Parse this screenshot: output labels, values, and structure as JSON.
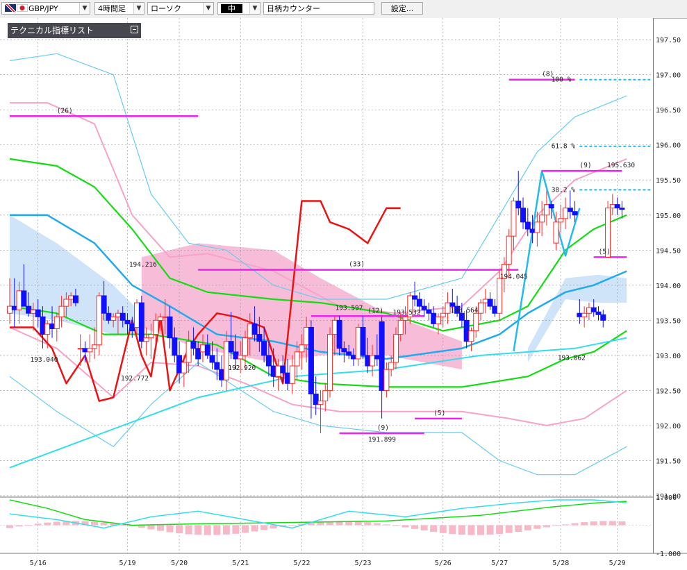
{
  "toolbar": {
    "pair": "GBP/JPY",
    "timeframe": "4時間足",
    "chart_style": "ローソク",
    "size": "中",
    "counter": "日柄カウンター",
    "settings": "設定..."
  },
  "legend_panel": {
    "title": "テクニカル指標リスト"
  },
  "colors": {
    "up_candle": "#ff2a2a",
    "down_candle": "#1010ff",
    "kumo_bull": "#f7bdd8",
    "kumo_bear": "#cfe4f8",
    "ma_green": "#11dd11",
    "ma_blue": "#22aaee",
    "ma_cyan": "#33ddee",
    "bb_pink": "#f7a2c9",
    "bb_sky": "#66ccf0",
    "chikou_red": "#ee1111",
    "magenta": "#ee22ee",
    "fib": "#22bbee"
  },
  "chart_data": {
    "type": "candlestick",
    "symbol": "GBP/JPY",
    "timeframe": "4時間足",
    "ylim": [
      191.0,
      197.6
    ],
    "y_ticks": [
      "197.50",
      "197.00",
      "196.50",
      "196.00",
      "195.50",
      "195.00",
      "194.50",
      "194.00",
      "193.50",
      "193.00",
      "192.50",
      "192.00",
      "191.50",
      "191.00"
    ],
    "y_tick_values": [
      197.5,
      197.0,
      196.5,
      196.0,
      195.5,
      195.0,
      194.5,
      194.0,
      193.5,
      193.0,
      192.5,
      192.0,
      191.5,
      191.0
    ],
    "x_labels": [
      "5/16",
      "5/19",
      "5/20",
      "5/21",
      "5/22",
      "5/23",
      "5/26",
      "5/27",
      "5/28",
      "5/29"
    ],
    "x_label_index": [
      6,
      25,
      36,
      49,
      62,
      75,
      92,
      104,
      117,
      129
    ],
    "candles": [
      [
        0,
        193.6,
        194.1,
        193.45,
        193.7
      ],
      [
        1,
        193.7,
        194.1,
        193.4,
        193.65
      ],
      [
        2,
        193.65,
        194.05,
        193.45,
        193.92
      ],
      [
        3,
        193.92,
        194.3,
        193.7,
        193.7
      ],
      [
        4,
        193.7,
        193.9,
        193.55,
        193.6
      ],
      [
        5,
        193.6,
        193.75,
        193.35,
        193.65
      ],
      [
        6,
        193.65,
        193.8,
        193.4,
        193.55
      ],
      [
        7,
        193.55,
        193.7,
        193.1,
        193.3
      ],
      [
        8,
        193.3,
        193.5,
        193.1,
        193.45
      ],
      [
        9,
        193.45,
        193.7,
        193.25,
        193.38
      ],
      [
        10,
        193.38,
        193.6,
        193.2,
        193.55
      ],
      [
        11,
        193.55,
        193.85,
        193.4,
        193.7
      ],
      [
        12,
        193.7,
        193.9,
        193.55,
        193.8
      ],
      [
        13,
        193.8,
        193.9,
        193.7,
        193.85
      ],
      [
        14,
        193.85,
        193.95,
        193.7,
        193.75
      ],
      [
        15,
        193.1,
        193.3,
        192.85,
        193.1
      ],
      [
        16,
        193.1,
        193.2,
        192.9,
        193.05
      ],
      [
        17,
        193.05,
        193.3,
        192.9,
        193.1
      ],
      [
        18,
        193.1,
        193.4,
        192.95,
        193.15
      ],
      [
        19,
        193.15,
        193.9,
        193.0,
        193.85
      ],
      [
        20,
        193.85,
        194.06,
        193.5,
        193.6
      ],
      [
        21,
        193.6,
        193.7,
        193.45,
        193.5
      ],
      [
        22,
        193.5,
        193.6,
        193.4,
        193.55
      ],
      [
        23,
        193.55,
        193.65,
        193.3,
        193.6
      ],
      [
        24,
        193.6,
        193.7,
        193.4,
        193.5
      ],
      [
        25,
        193.5,
        193.6,
        193.3,
        193.45
      ],
      [
        26,
        193.45,
        193.55,
        193.25,
        193.35
      ],
      [
        27,
        193.4,
        193.8,
        193.3,
        193.75
      ],
      [
        28,
        193.75,
        193.85,
        193.1,
        193.2
      ],
      [
        29,
        193.2,
        193.4,
        193.0,
        193.25
      ],
      [
        30,
        193.25,
        193.45,
        192.95,
        193.3
      ],
      [
        31,
        193.3,
        193.6,
        193.1,
        193.5
      ],
      [
        32,
        193.5,
        193.6,
        193.35,
        193.55
      ],
      [
        33,
        193.55,
        193.8,
        193.3,
        193.55
      ],
      [
        34,
        193.55,
        193.7,
        193.1,
        193.25
      ],
      [
        35,
        193.25,
        193.4,
        192.9,
        193.0
      ],
      [
        36,
        193.0,
        193.2,
        192.6,
        192.75
      ],
      [
        37,
        192.75,
        193.0,
        192.55,
        192.9
      ],
      [
        38,
        192.9,
        193.35,
        192.75,
        193.2
      ],
      [
        39,
        193.2,
        193.4,
        193.0,
        193.1
      ],
      [
        40,
        193.1,
        193.2,
        192.85,
        192.95
      ],
      [
        41,
        193.05,
        193.3,
        192.9,
        193.15
      ],
      [
        42,
        193.15,
        193.3,
        192.95,
        193.0
      ],
      [
        43,
        193.0,
        193.2,
        192.8,
        192.9
      ],
      [
        44,
        192.9,
        193.1,
        192.65,
        192.8
      ],
      [
        45,
        192.8,
        193.0,
        192.55,
        192.65
      ],
      [
        46,
        192.65,
        193.35,
        192.5,
        193.2
      ],
      [
        47,
        193.2,
        193.62,
        192.95,
        193.05
      ],
      [
        48,
        193.05,
        193.3,
        192.8,
        192.95
      ],
      [
        49,
        192.95,
        193.2,
        192.75,
        193.0
      ],
      [
        50,
        193.0,
        193.35,
        192.8,
        193.25
      ],
      [
        51,
        193.25,
        193.6,
        193.0,
        193.45
      ],
      [
        52,
        193.45,
        193.7,
        193.2,
        193.3
      ],
      [
        53,
        193.3,
        193.55,
        193.05,
        193.2
      ],
      [
        54,
        193.2,
        193.4,
        192.9,
        193.0
      ],
      [
        55,
        193.0,
        193.2,
        192.7,
        192.85
      ],
      [
        56,
        192.85,
        193.1,
        192.55,
        192.7
      ],
      [
        57,
        192.7,
        192.95,
        192.5,
        192.85
      ],
      [
        58,
        192.85,
        193.0,
        192.6,
        192.75
      ],
      [
        59,
        192.75,
        192.95,
        192.5,
        192.6
      ],
      [
        60,
        192.6,
        193.0,
        192.45,
        192.85
      ],
      [
        61,
        192.85,
        193.2,
        192.65,
        193.05
      ],
      [
        62,
        193.05,
        193.3,
        192.8,
        193.15
      ],
      [
        63,
        193.15,
        193.55,
        192.9,
        193.4
      ],
      [
        64,
        193.4,
        193.5,
        192.1,
        192.45
      ],
      [
        65,
        192.45,
        192.7,
        192.15,
        192.3
      ],
      [
        66,
        192.3,
        192.5,
        191.89,
        192.35
      ],
      [
        67,
        192.35,
        192.6,
        192.2,
        192.5
      ],
      [
        68,
        192.5,
        193.4,
        192.4,
        193.3
      ],
      [
        69,
        193.3,
        193.55,
        193.0,
        193.5
      ],
      [
        70,
        193.5,
        193.56,
        193.0,
        193.1
      ],
      [
        71,
        193.1,
        193.2,
        192.9,
        193.05
      ],
      [
        72,
        193.05,
        193.15,
        192.95,
        193.0
      ],
      [
        73,
        193.0,
        193.1,
        192.85,
        192.95
      ],
      [
        74,
        192.95,
        193.45,
        192.85,
        193.4
      ],
      [
        75,
        193.4,
        193.56,
        192.95,
        193.0
      ],
      [
        76,
        193.0,
        193.25,
        192.75,
        192.85
      ],
      [
        77,
        192.85,
        193.15,
        192.7,
        193.0
      ],
      [
        78,
        193.0,
        193.3,
        192.85,
        192.95
      ],
      [
        79,
        193.48,
        193.55,
        192.1,
        192.5
      ],
      [
        80,
        192.5,
        192.9,
        192.4,
        192.8
      ],
      [
        81,
        192.8,
        193.0,
        192.7,
        192.9
      ],
      [
        82,
        192.9,
        193.4,
        192.8,
        193.3
      ],
      [
        83,
        193.3,
        193.6,
        193.2,
        193.5
      ],
      [
        84,
        193.5,
        193.7,
        193.3,
        193.55
      ],
      [
        85,
        193.55,
        193.9,
        193.45,
        193.85
      ],
      [
        86,
        193.85,
        194.05,
        193.7,
        193.8
      ],
      [
        87,
        193.8,
        193.9,
        193.6,
        193.7
      ],
      [
        88,
        193.7,
        193.8,
        193.55,
        193.65
      ],
      [
        89,
        193.65,
        193.75,
        193.5,
        193.6
      ],
      [
        90,
        193.6,
        193.7,
        193.4,
        193.45
      ],
      [
        91,
        193.45,
        193.6,
        193.3,
        193.55
      ],
      [
        92,
        193.55,
        193.7,
        193.4,
        193.6
      ],
      [
        93,
        193.6,
        193.9,
        193.45,
        193.75
      ],
      [
        94,
        193.75,
        193.95,
        193.6,
        193.7
      ],
      [
        95,
        193.7,
        193.85,
        193.55,
        193.6
      ],
      [
        96,
        193.6,
        193.75,
        193.4,
        193.5
      ],
      [
        97,
        193.5,
        193.65,
        193.1,
        193.2
      ],
      [
        98,
        193.2,
        193.4,
        193.06,
        193.35
      ],
      [
        99,
        193.35,
        193.7,
        193.25,
        193.6
      ],
      [
        100,
        193.6,
        193.8,
        193.5,
        193.75
      ],
      [
        101,
        193.75,
        193.95,
        193.6,
        193.8
      ],
      [
        102,
        193.8,
        193.9,
        193.65,
        193.7
      ],
      [
        103,
        193.7,
        193.8,
        193.55,
        193.6
      ],
      [
        104,
        193.6,
        194.2,
        193.5,
        194.1
      ],
      [
        105,
        194.1,
        194.4,
        193.9,
        194.3
      ],
      [
        106,
        194.3,
        194.8,
        194.1,
        194.7
      ],
      [
        107,
        194.7,
        195.25,
        194.5,
        195.2
      ],
      [
        108,
        195.2,
        195.63,
        195.0,
        195.1
      ],
      [
        109,
        195.1,
        195.25,
        194.8,
        194.9
      ],
      [
        110,
        194.9,
        195.1,
        194.7,
        194.8
      ],
      [
        111,
        194.8,
        195.0,
        194.6,
        194.75
      ],
      [
        112,
        194.75,
        195.05,
        194.55,
        194.9
      ],
      [
        113,
        194.9,
        195.2,
        194.7,
        195.0
      ],
      [
        114,
        195.0,
        195.35,
        194.85,
        195.15
      ],
      [
        115,
        195.15,
        195.2,
        194.95,
        195.1
      ],
      [
        116,
        194.6,
        195.05,
        194.5,
        194.9
      ],
      [
        117,
        194.9,
        195.15,
        194.75,
        194.95
      ],
      [
        118,
        194.95,
        195.25,
        194.8,
        195.1
      ],
      [
        119,
        195.1,
        195.35,
        194.95,
        195.05
      ],
      [
        120,
        195.05,
        195.2,
        194.9,
        195.0
      ],
      [
        121,
        193.6,
        193.8,
        193.45,
        193.55
      ],
      [
        122,
        193.55,
        193.7,
        193.4,
        193.6
      ],
      [
        123,
        193.6,
        193.75,
        193.5,
        193.68
      ],
      [
        124,
        193.68,
        193.8,
        193.55,
        193.62
      ],
      [
        125,
        193.62,
        193.7,
        193.5,
        193.58
      ],
      [
        126,
        193.58,
        193.65,
        193.4,
        193.5
      ],
      [
        127,
        194.4,
        195.2,
        194.4,
        195.1
      ],
      [
        128,
        195.1,
        195.3,
        195.0,
        195.15
      ],
      [
        129,
        195.15,
        195.25,
        195.0,
        195.1
      ],
      [
        130,
        195.1,
        195.2,
        194.95,
        195.08
      ]
    ],
    "price_labels": [
      {
        "text": "194.216",
        "x": 16,
        "y": 194.216
      },
      {
        "text": "193.040",
        "x": 4,
        "y": 193.04
      },
      {
        "text": "192.772",
        "x": 15,
        "y": 192.772
      },
      {
        "text": "192.920",
        "x": 28,
        "y": 192.92
      },
      {
        "text": "193.597",
        "x": 41,
        "y": 193.597
      },
      {
        "text": "191.899",
        "x": 45,
        "y": 191.899
      },
      {
        "text": "193.532",
        "x": 48,
        "y": 193.532
      },
      {
        "text": "193.564",
        "x": 55,
        "y": 193.564
      },
      {
        "text": "194.045",
        "x": 61,
        "y": 194.045
      },
      {
        "text": "193.062",
        "x": 68,
        "y": 193.062
      },
      {
        "text": "195.630",
        "x": 74,
        "y": 195.63
      }
    ],
    "count_labels": [
      "(26)",
      "(33)",
      "(12)",
      "(9)",
      "(5)",
      "(8)",
      "(9)",
      "(5)"
    ],
    "fib_labels": [
      "100 %",
      "61.8 %",
      "38.2 %"
    ],
    "osc_axis": [
      "1.000",
      "-1.000"
    ],
    "osc_ylim": [
      -1.0,
      1.0
    ]
  }
}
